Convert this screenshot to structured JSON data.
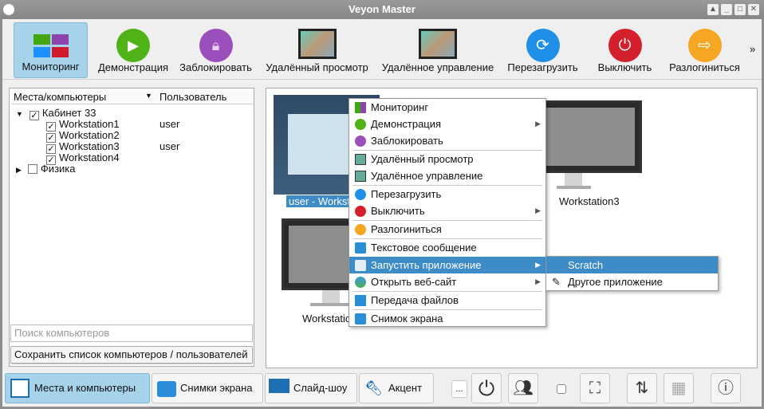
{
  "window": {
    "title": "Veyon Master"
  },
  "toolbar": {
    "items": [
      {
        "label": "Мониторинг",
        "icon": "monitoring-icon"
      },
      {
        "label": "Демонстрация",
        "icon": "demo-icon"
      },
      {
        "label": "Заблокировать",
        "icon": "lock-icon"
      },
      {
        "label": "Удалённый просмотр",
        "icon": "remote-view-icon"
      },
      {
        "label": "Удалённое управление",
        "icon": "remote-control-icon"
      },
      {
        "label": "Перезагрузить",
        "icon": "reboot-icon"
      },
      {
        "label": "Выключить",
        "icon": "power-icon"
      },
      {
        "label": "Разлогиниться",
        "icon": "logout-icon"
      }
    ],
    "more": "»"
  },
  "tree": {
    "col1": "Места/компьютеры",
    "col2": "Пользователь",
    "groups": [
      {
        "name": "Кабинет 33",
        "checked": true,
        "children": [
          {
            "name": "Workstation1",
            "user": "user"
          },
          {
            "name": "Workstation2",
            "user": ""
          },
          {
            "name": "Workstation3",
            "user": "user"
          },
          {
            "name": "Workstation4",
            "user": ""
          }
        ]
      },
      {
        "name": "Физика",
        "checked": false
      }
    ]
  },
  "search": {
    "placeholder": "Поиск компьютеров"
  },
  "save_button": "Сохранить список компьютеров / пользователей",
  "tiles": [
    {
      "label": "user - Workstation1"
    },
    {
      "label": "Workstation3"
    },
    {
      "label": "Workstation4"
    }
  ],
  "context_menu": {
    "items": [
      "Мониторинг",
      "Демонстрация",
      "Заблокировать",
      "Удалённый просмотр",
      "Удалённое управление",
      "Перезагрузить",
      "Выключить",
      "Разлогиниться",
      "Текстовое сообщение",
      "Запустить приложение",
      "Открыть веб-сайт",
      "Передача файлов",
      "Снимок экрана"
    ]
  },
  "submenu": {
    "items": [
      "Scratch",
      "Другое приложение"
    ]
  },
  "bottom": {
    "tabs": [
      {
        "label": "Места и компьютеры"
      },
      {
        "label": "Снимки экрана"
      },
      {
        "label": "Слайд-шоу"
      },
      {
        "label": "Акцент"
      }
    ],
    "dots": "..."
  },
  "colors": {
    "accent": "#3d8cc8",
    "selected_tab": "#a7d3ea"
  }
}
